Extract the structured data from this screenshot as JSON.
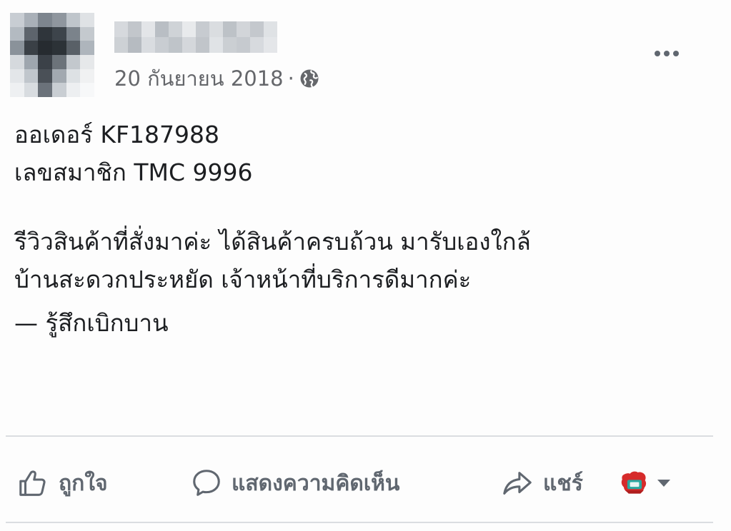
{
  "post": {
    "date": "20 กันยายน 2018",
    "separator": "·",
    "privacy_icon": "globe-icon",
    "more_icon": "more-dots-icon",
    "body_lines": [
      "ออเดอร์ KF187988",
      "เลขสมาชิก TMC 9996",
      "",
      "รีวิวสินค้าที่สั่งมาค่ะ ได้สินค้าครบถ้วน มารับเองใกล้",
      "บ้านสะดวกประหยัด เจ้าหน้าที่บริการดีมากค่ะ"
    ],
    "feeling": "— รู้สึกเบิกบาน"
  },
  "actions": {
    "like_label": "ถูกใจ",
    "comment_label": "แสดงความคิดเห็น",
    "share_label": "แชร์"
  },
  "colors": {
    "text": "#1c1e21",
    "secondary_text": "#65676b",
    "action_grey": "#606770",
    "divider": "#dadde1",
    "audience_avatar_red": "#d62b2b"
  }
}
